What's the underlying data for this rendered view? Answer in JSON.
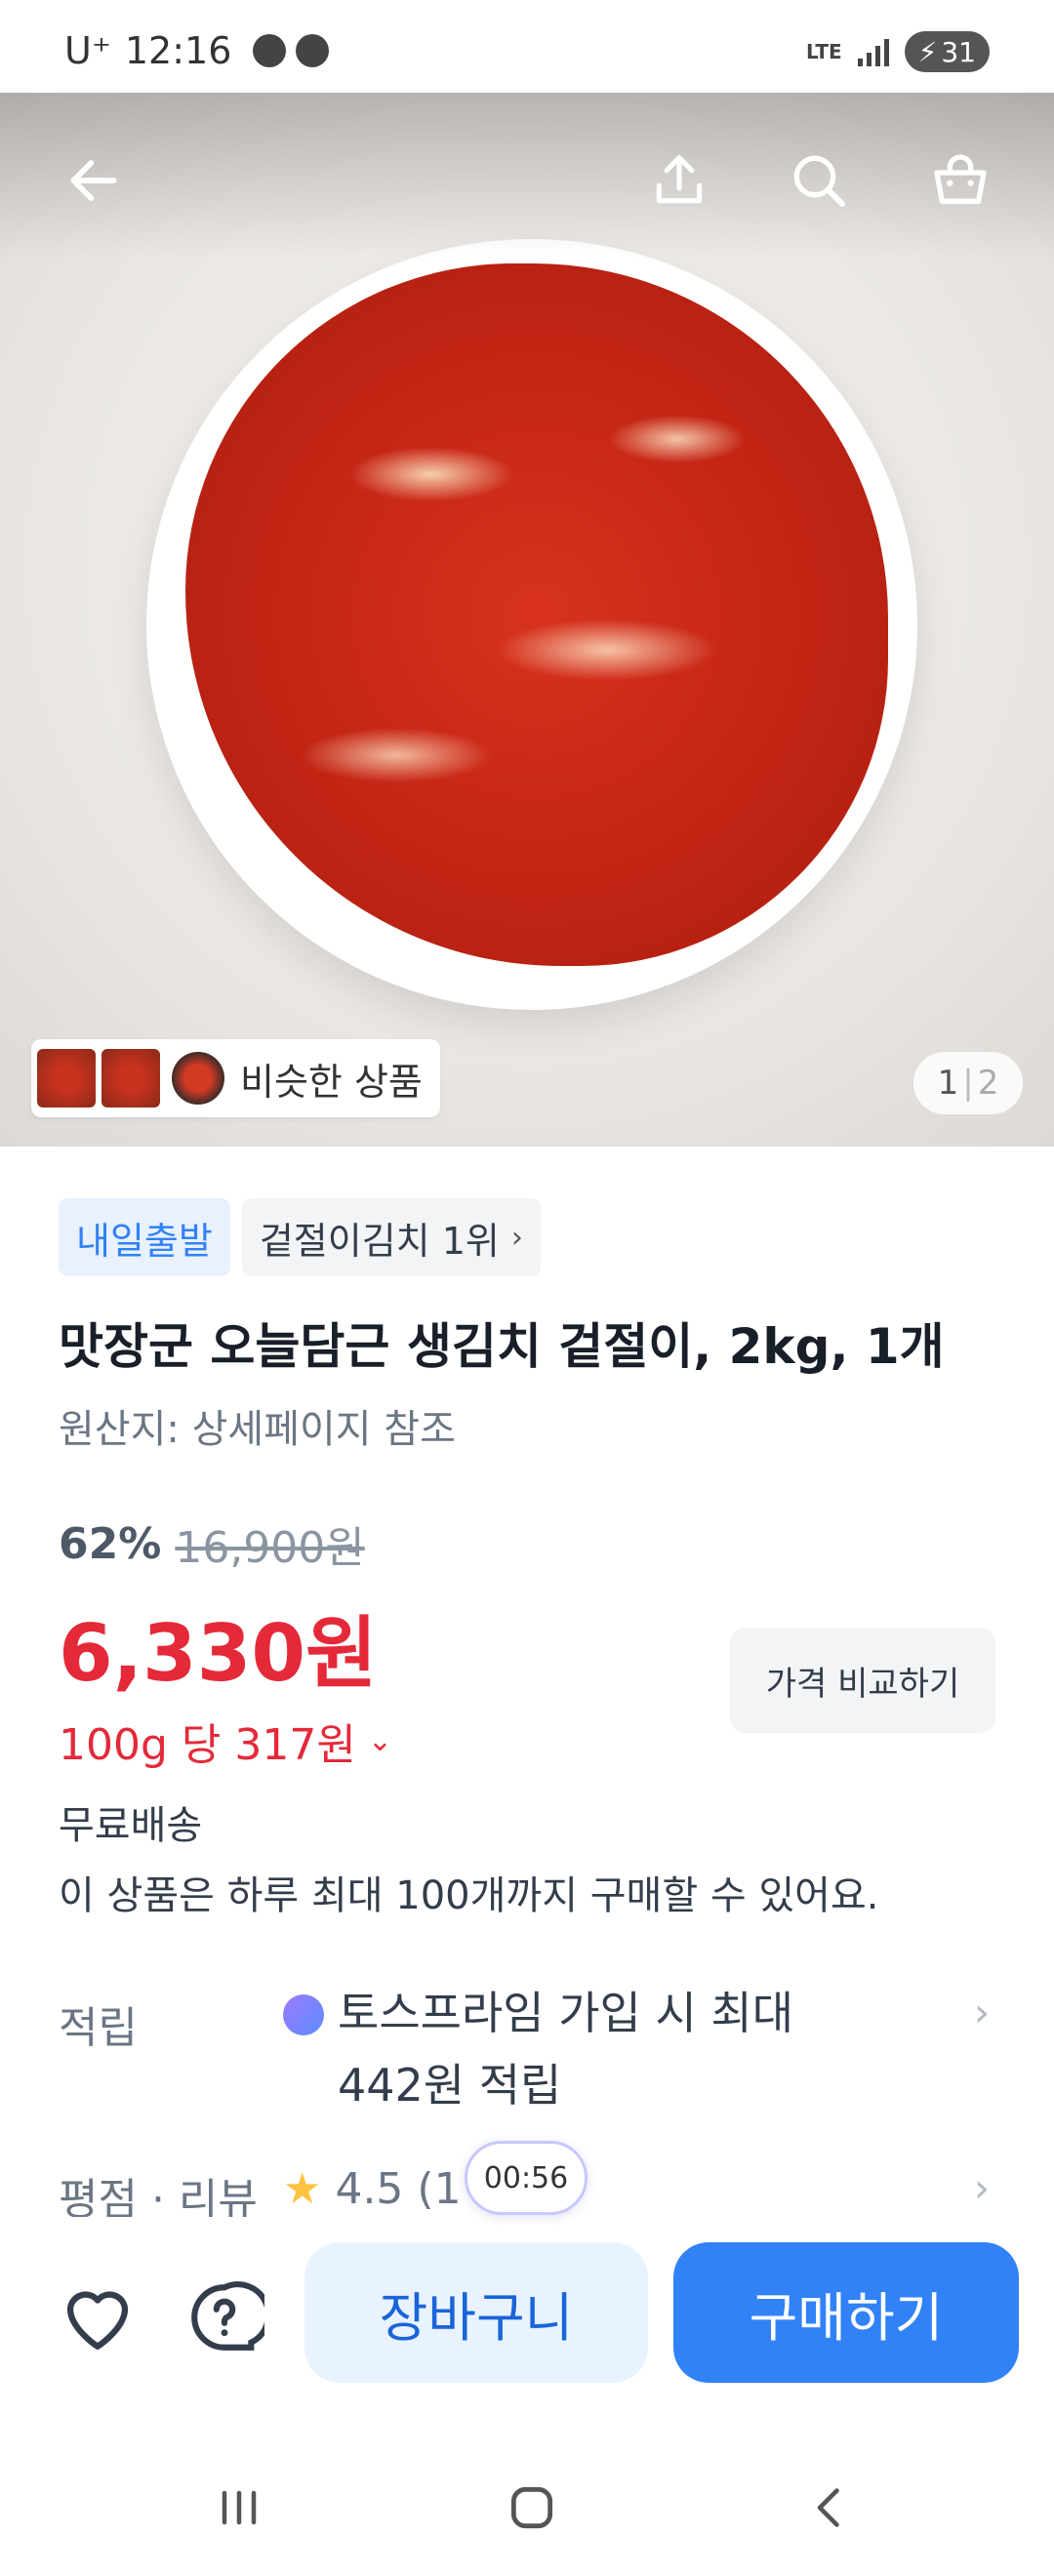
{
  "status_bar": {
    "carrier": "U⁺",
    "time": "12:16",
    "network": "LTE",
    "battery": "31"
  },
  "hero": {
    "icons": [
      "back-arrow-icon",
      "share-icon",
      "search-icon",
      "shopping-bag-icon"
    ],
    "similar_products_label": "비슷한 상품",
    "page_current": "1",
    "page_total": "2"
  },
  "product": {
    "badge_delivery": "내일출발",
    "badge_rank": "겉절이김치 1위",
    "title": "맛장군 오늘담근 생김치 겉절이, 2kg, 1개",
    "origin": "원산지: 상세페이지 참조",
    "discount": "62%",
    "original_price": "16,900원",
    "price": "6,330원",
    "unit_price": "100g 당 317원",
    "compare_button": "가격 비교하기",
    "shipping": "무료배송",
    "purchase_limit": "이 상품은 하루 최대 100개까지 구매할 수 있어요."
  },
  "points": {
    "label": "적립",
    "line1": "토스프라임 가입 시 최대",
    "line2": "442원 적립"
  },
  "reviews": {
    "label": "평점 · 리뷰",
    "rating_text": "4.5 (1"
  },
  "timer": "00:56",
  "actions": {
    "cart": "장바구니",
    "buy": "구매하기"
  },
  "colors": {
    "accent_blue": "#3182f6",
    "price_red": "#e42939",
    "cart_bg": "#e8f3ff"
  }
}
